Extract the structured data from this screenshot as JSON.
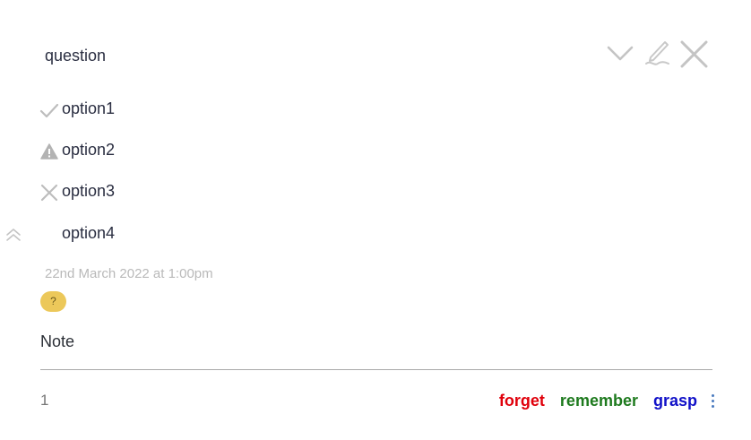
{
  "card": {
    "question": "question",
    "options": [
      {
        "label": "option1",
        "icon": "check-icon"
      },
      {
        "label": "option2",
        "icon": "warning-icon"
      },
      {
        "label": "option3",
        "icon": "cross-icon"
      },
      {
        "label": "option4",
        "icon": ""
      }
    ],
    "timestamp": "22nd March 2022 at 1:00pm",
    "tag": "?",
    "note": "Note",
    "count": "1"
  },
  "toolbar": {
    "icons": [
      "chevron-down-icon",
      "edit-icon",
      "close-icon"
    ]
  },
  "actions": {
    "forget": "forget",
    "remember": "remember",
    "grasp": "grasp"
  },
  "colors": {
    "forget": "#e0000b",
    "remember": "#1e7a1e",
    "grasp": "#1010c8",
    "tag_badge": "#ecc85a",
    "icon_gray": "#bdbdbd"
  }
}
